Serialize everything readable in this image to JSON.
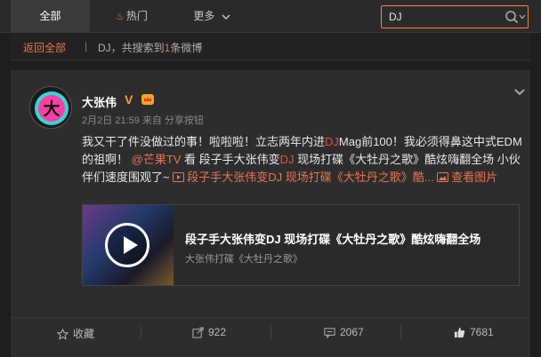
{
  "nav": {
    "tabs": [
      {
        "label": "全部",
        "active": true
      },
      {
        "label": "热门",
        "icon": "fire-icon"
      },
      {
        "label": "更多",
        "icon": "chevron-down-icon"
      }
    ]
  },
  "search": {
    "value": "DJ",
    "icon": "search-icon"
  },
  "breadcrumb": {
    "back": "返回全部",
    "sep": "|",
    "prefix": "DJ，共搜索到",
    "count": "1",
    "suffix": "条微博"
  },
  "post": {
    "username": "大张伟",
    "verified": "V",
    "meta": "2月2日 21:59 来自 分享按钮",
    "text": {
      "p1": "我又干了件没做过的事！啦啦啦！立志两年内进",
      "hl1": "DJ",
      "p2": "Mag前100！我必须得鼻这中式EDM的祖啊！ ",
      "mention": "@芒果TV",
      "p3": " 看 段子手大张伟变",
      "hl2": "DJ",
      "p4": " 现场打碟《大牡丹之歌》酷炫嗨翻全场 小伙伴们速度围观了~ ",
      "video_link": "段子手大张伟变DJ 现场打碟《大牡丹之歌》酷...",
      "view_images": "查看图片"
    },
    "media": {
      "title": "段子手大张伟变DJ 现场打碟《大牡丹之歌》酷炫嗨翻全场",
      "subtitle": "大张伟打碟《大牡丹之歌》"
    },
    "actions": {
      "favorite": "收藏",
      "forward": "922",
      "comment": "2067",
      "like": "7681"
    }
  },
  "colors": {
    "accent": "#eb7350",
    "highlight": "#eb4f38",
    "background": "#1e1e1e",
    "card": "#2d2d2d"
  }
}
